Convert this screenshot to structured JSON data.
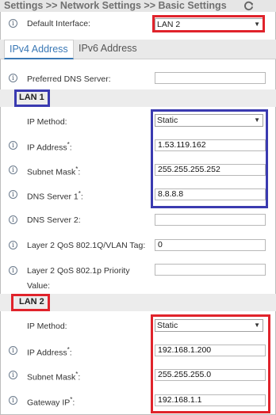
{
  "header": {
    "title": "Settings >> Network Settings >> Basic Settings",
    "refresh_icon": "refresh-icon"
  },
  "default_interface": {
    "label": "Default Interface:",
    "value": "LAN 2"
  },
  "tabs": [
    {
      "label": "IPv4 Address"
    },
    {
      "label": "IPv6 Address"
    }
  ],
  "preferred_dns": {
    "label": "Preferred DNS Server:",
    "value": ""
  },
  "lan1": {
    "title": "LAN 1",
    "ip_method": {
      "label": "IP Method:",
      "value": "Static"
    },
    "ip_address": {
      "label": "IP Address",
      "value": "1.53.119.162"
    },
    "subnet_mask": {
      "label": "Subnet Mask",
      "value": "255.255.255.252"
    },
    "dns1": {
      "label": "DNS Server 1",
      "value": "8.8.8.8"
    },
    "dns2": {
      "label": "DNS Server 2:",
      "value": ""
    },
    "qos_vlan": {
      "label": "Layer 2 QoS 802.1Q/VLAN Tag:",
      "value": "0"
    },
    "qos_priority": {
      "label": "Layer 2 QoS 802.1p Priority",
      "label2": "Value:",
      "value": ""
    }
  },
  "lan2": {
    "title": "LAN 2",
    "ip_method": {
      "label": "IP Method:",
      "value": "Static"
    },
    "ip_address": {
      "label": "IP Address",
      "value": "192.168.1.200"
    },
    "subnet_mask": {
      "label": "Subnet Mask",
      "value": "255.255.255.0"
    },
    "gateway": {
      "label": "Gateway IP",
      "value": "192.168.1.1"
    }
  },
  "required_mark": "*",
  "info_glyph": "i",
  "colors": {
    "highlight_red": "#e0232b",
    "highlight_blue": "#3a3ab0",
    "tab_active": "#3a78b5"
  }
}
